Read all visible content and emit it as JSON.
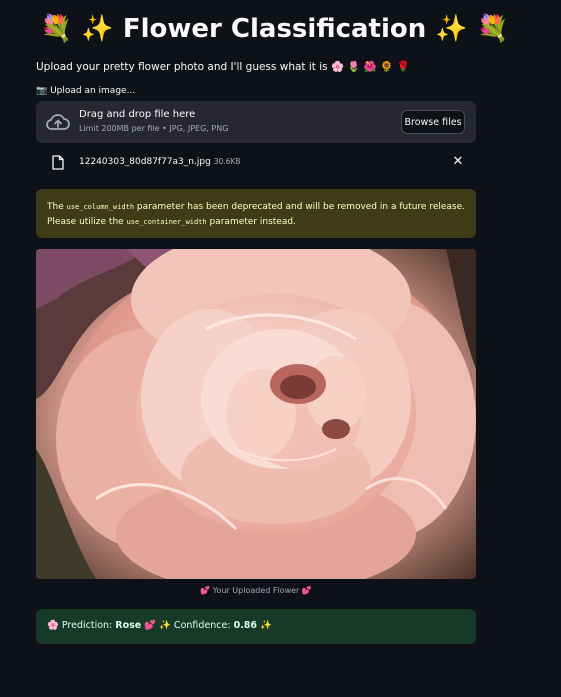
{
  "app": {
    "title": "💐 ✨ Flower Classification ✨ 💐",
    "subtitle": "Upload your pretty flower photo and I'll guess what it is 🌸 🌷 🌺 🌻 🌹"
  },
  "uploader": {
    "label": "📷 Upload an image...",
    "drop_title": "Drag and drop file here",
    "drop_sub": "Limit 200MB per file • JPG, JPEG, PNG",
    "browse_label": "Browse files",
    "icon": "cloud-upload-icon"
  },
  "file": {
    "name": "12240303_80d87f77a3_n.jpg",
    "size": "30.6KB",
    "icon": "file-icon",
    "remove_icon": "close-icon"
  },
  "warning": {
    "part1": "The ",
    "code1": "use_column_width",
    "part2": " parameter has been deprecated and will be removed in a future release. Please utilize the ",
    "code2": "use_container_width",
    "part3": " parameter instead."
  },
  "image": {
    "caption": "💕 Your Uploaded Flower 💕"
  },
  "result": {
    "prefix": "🌸 Prediction: ",
    "label": "Rose",
    "middle": " 💕 ✨ Confidence: ",
    "confidence": "0.86",
    "suffix": " ✨"
  },
  "colors": {
    "background": "#0e1117",
    "dropzone": "#262730",
    "warning_bg": "#3e3b16",
    "warning_text": "#ffffc2",
    "success_bg": "#173928",
    "success_text": "#dffde9"
  }
}
